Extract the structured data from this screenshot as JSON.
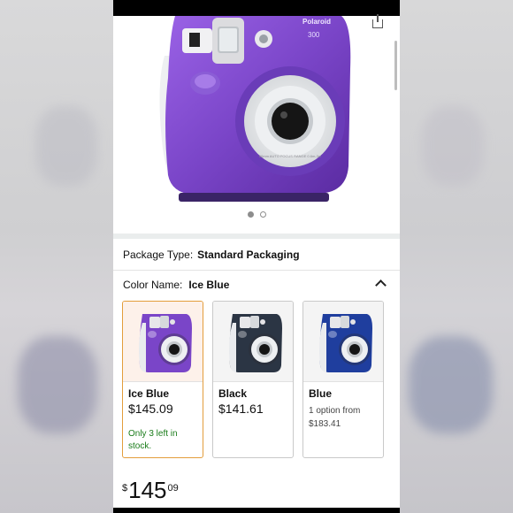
{
  "product": {
    "brand_text": "Polaroid",
    "model_text": "300",
    "lens_ring_text": "60mm AUTO FOCUS RANGE 0.6m-3m"
  },
  "gallery": {
    "dots": 2,
    "active_index": 0
  },
  "package": {
    "label": "Package Type:",
    "value": "Standard Packaging"
  },
  "color": {
    "label": "Color Name:",
    "value": "Ice Blue",
    "options": [
      {
        "name": "Ice Blue",
        "price": "$145.09",
        "note": "Only 3 left in stock.",
        "camera_color": "#7a45c8",
        "selected": true
      },
      {
        "name": "Black",
        "price": "$141.61",
        "note": "",
        "camera_color": "#2b3544",
        "selected": false
      },
      {
        "name": "Blue",
        "price": "",
        "note": "1 option from $183.41",
        "camera_color": "#1f3e9e",
        "selected": false
      }
    ]
  },
  "buybox": {
    "currency": "$",
    "whole": "145",
    "fraction": "09"
  },
  "colors": {
    "accent_selected": "#e39d3c",
    "stock_green": "#1a7c1a",
    "camera_purple": "#7a45c8"
  }
}
